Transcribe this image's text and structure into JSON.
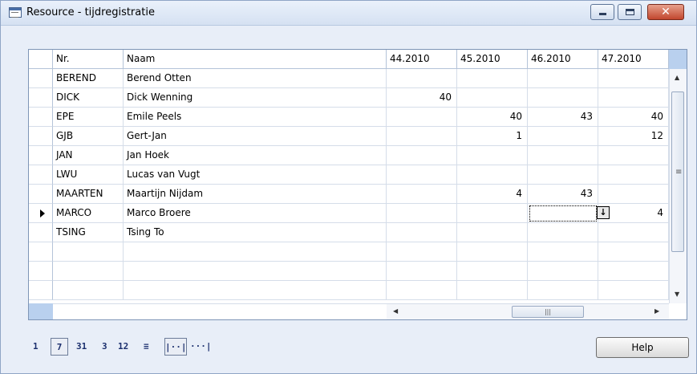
{
  "window": {
    "title": "Resource - tijdregistratie",
    "close_glyph": "✕"
  },
  "columns": [
    "Nr.",
    "Naam",
    "44.2010",
    "45.2010",
    "46.2010",
    "47.2010"
  ],
  "rows": [
    {
      "nr": "BEREND",
      "naam": "Berend Otten",
      "w44": "",
      "w45": "",
      "w46": "",
      "w47": ""
    },
    {
      "nr": "DICK",
      "naam": "Dick Wenning",
      "w44": "40",
      "w45": "",
      "w46": "",
      "w47": ""
    },
    {
      "nr": "EPE",
      "naam": "Emile Peels",
      "w44": "",
      "w45": "40",
      "w46": "43",
      "w47": "40"
    },
    {
      "nr": "GJB",
      "naam": "Gert-Jan",
      "w44": "",
      "w45": "1",
      "w46": "",
      "w47": "12"
    },
    {
      "nr": "JAN",
      "naam": "Jan Hoek",
      "w44": "",
      "w45": "",
      "w46": "",
      "w47": ""
    },
    {
      "nr": "LWU",
      "naam": "Lucas van Vugt",
      "w44": "",
      "w45": "",
      "w46": "",
      "w47": ""
    },
    {
      "nr": "MAARTEN",
      "naam": "Maartijn Nijdam",
      "w44": "",
      "w45": "4",
      "w46": "43",
      "w47": ""
    },
    {
      "nr": "MARCO",
      "naam": "Marco Broere",
      "w44": "",
      "w45": "",
      "w46": "",
      "w47": "4"
    },
    {
      "nr": "TSING",
      "naam": "Tsing To",
      "w44": "",
      "w45": "",
      "w46": "",
      "w47": ""
    }
  ],
  "active_row_index": 7,
  "toolbar": {
    "day": "1",
    "week": "7",
    "month": "31",
    "quarter": "3",
    "year": "12",
    "period": "≡",
    "net_change": "|··|",
    "balance": "···|"
  },
  "help_label": "Help"
}
